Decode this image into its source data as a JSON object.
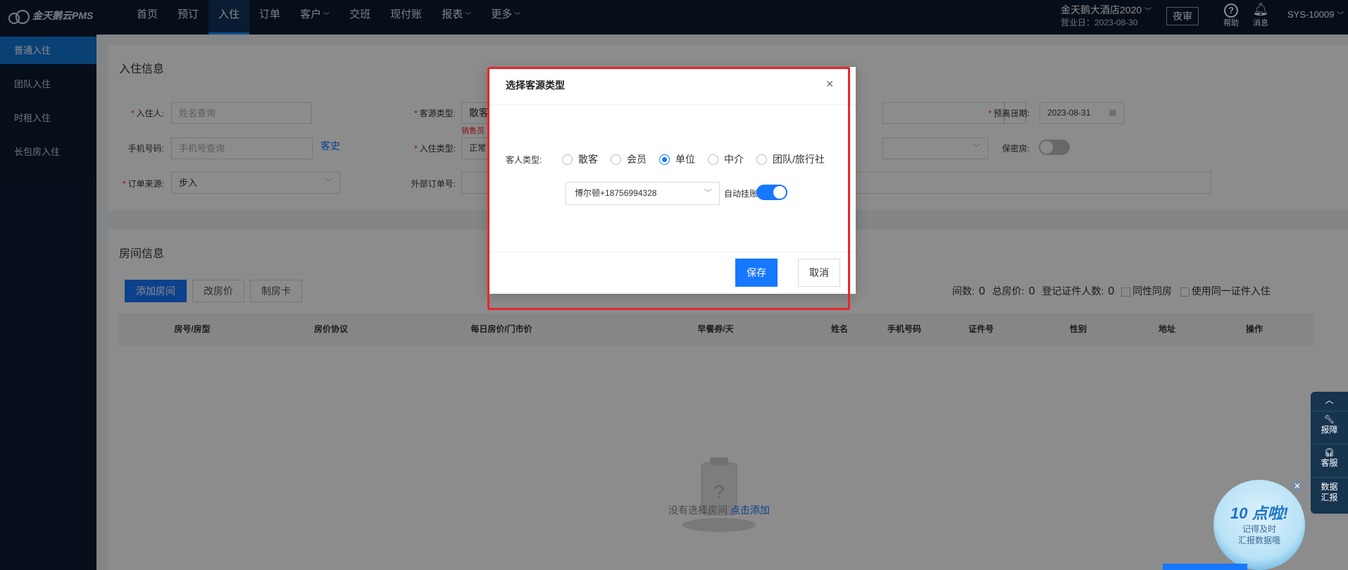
{
  "topbar": {
    "logo": "金天鹅云PMS",
    "nav": [
      {
        "label": "首页",
        "chevron": false
      },
      {
        "label": "预订",
        "chevron": false
      },
      {
        "label": "入住",
        "chevron": false,
        "active": true
      },
      {
        "label": "订单",
        "chevron": false
      },
      {
        "label": "客户",
        "chevron": true
      },
      {
        "label": "交班",
        "chevron": false
      },
      {
        "label": "现付账",
        "chevron": false
      },
      {
        "label": "报表",
        "chevron": true
      },
      {
        "label": "更多",
        "chevron": true
      }
    ],
    "hotel": "金天鹅大酒店2020",
    "business_day": "营业日：2023-08-30",
    "night_audit": "夜审",
    "help": "帮助",
    "messages": "消息",
    "user": "SYS-10009"
  },
  "sidebar": {
    "items": [
      "普通入住",
      "团队入住",
      "时租入住",
      "长包房入住"
    ]
  },
  "checkin_info": {
    "title": "入住信息",
    "guest_label": "入住人:",
    "guest_placeholder": "姓名查询",
    "phone_label": "手机号码:",
    "phone_placeholder": "手机号查询",
    "history_link": "客史",
    "order_source_label": "订单来源:",
    "order_source_value": "步入",
    "source_type_label": "客源类型:",
    "source_type_value": "散客",
    "salesperson_hint": "销售员",
    "checkin_type_label": "入住类型:",
    "checkin_type_value": "正常",
    "external_order_label": "外部订单号:",
    "plus": "+",
    "departure_label": "预离日期:",
    "departure_value": "2023-08-31",
    "secret_room_label": "保密房:"
  },
  "room_info": {
    "title": "房间信息",
    "add_room": "添加房间",
    "change_price": "改房价",
    "make_card": "制房卡",
    "rooms_label": "间数:",
    "rooms_value": "0",
    "total_price_label": "总房价:",
    "total_price_value": "0",
    "id_count_label": "登记证件人数:",
    "id_count_value": "0",
    "same_gender": "同性同房",
    "same_id": "使用同一证件入住",
    "columns": [
      "房号/房型",
      "房价协议",
      "每日房价/门市价",
      "早餐券/天",
      "姓名",
      "手机号码",
      "证件号",
      "性别",
      "地址",
      "操作"
    ],
    "empty_text": "没有选择房间",
    "empty_link": "点击添加"
  },
  "float_bar": {
    "items": [
      "报障",
      "客服",
      "数据汇报"
    ]
  },
  "promo": {
    "headline": "10 点啦!",
    "line1": "记得及时",
    "line2": "汇报数据哦"
  },
  "modal": {
    "title": "选择客源类型",
    "guest_type_label": "客人类型:",
    "options": [
      "散客",
      "会员",
      "单位",
      "中介",
      "团队/旅行社"
    ],
    "selected": "单位",
    "company_value": "博尔顿+18756994328",
    "auto_hang_label": "自动挂账",
    "auto_hang_on": true,
    "save": "保存",
    "cancel": "取消"
  }
}
